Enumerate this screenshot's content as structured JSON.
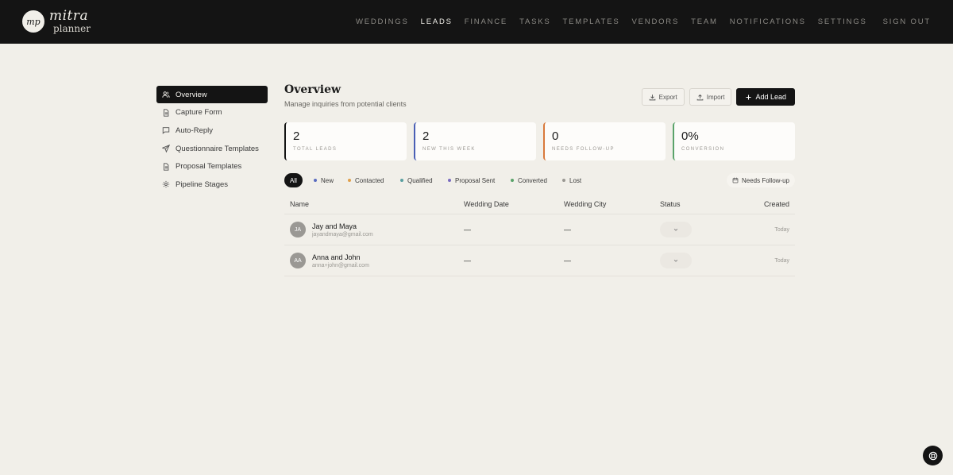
{
  "brand": {
    "line1": "mitra",
    "line2": "planner",
    "mark": "mp"
  },
  "nav": {
    "items": [
      "WEDDINGS",
      "LEADS",
      "FINANCE",
      "TASKS",
      "TEMPLATES",
      "VENDORS",
      "TEAM",
      "NOTIFICATIONS",
      "SETTINGS"
    ],
    "active": "LEADS",
    "signout": "SIGN OUT"
  },
  "sidebar": {
    "items": [
      {
        "label": "Overview",
        "icon": "users-icon"
      },
      {
        "label": "Capture Form",
        "icon": "document-icon"
      },
      {
        "label": "Auto-Reply",
        "icon": "message-icon"
      },
      {
        "label": "Questionnaire Templates",
        "icon": "send-icon"
      },
      {
        "label": "Proposal Templates",
        "icon": "document-icon"
      },
      {
        "label": "Pipeline Stages",
        "icon": "gear-icon"
      }
    ],
    "active_index": 0
  },
  "header": {
    "title": "Overview",
    "subtitle": "Manage inquiries from potential clients",
    "export_label": "Export",
    "import_label": "Import",
    "add_label": "Add Lead"
  },
  "stats": [
    {
      "value": "2",
      "label": "TOTAL LEADS",
      "color": "#141414"
    },
    {
      "value": "2",
      "label": "NEW THIS WEEK",
      "color": "#4a5fb5"
    },
    {
      "value": "0",
      "label": "NEEDS FOLLOW-UP",
      "color": "#d9793b"
    },
    {
      "value": "0%",
      "label": "CONVERSION",
      "color": "#5aa36a"
    }
  ],
  "filters": {
    "chips": [
      {
        "label": "All",
        "dot": ""
      },
      {
        "label": "New",
        "dot": "#5a6cc0"
      },
      {
        "label": "Contacted",
        "dot": "#e0a04c"
      },
      {
        "label": "Qualified",
        "dot": "#5a9fa0"
      },
      {
        "label": "Proposal Sent",
        "dot": "#7a6cc0"
      },
      {
        "label": "Converted",
        "dot": "#5aa36a"
      },
      {
        "label": "Lost",
        "dot": "#9a9893"
      }
    ],
    "follow_up": "Needs Follow-up"
  },
  "table": {
    "columns": [
      "Name",
      "Wedding Date",
      "Wedding City",
      "Status",
      "Created"
    ],
    "rows": [
      {
        "initials": "JA",
        "name": "Jay and Maya",
        "email": "jayandmaya@gmail.com",
        "date": "—",
        "city": "—",
        "created": "Today"
      },
      {
        "initials": "AA",
        "name": "Anna and John",
        "email": "anna+john@gmail.com",
        "date": "—",
        "city": "—",
        "created": "Today"
      }
    ]
  }
}
